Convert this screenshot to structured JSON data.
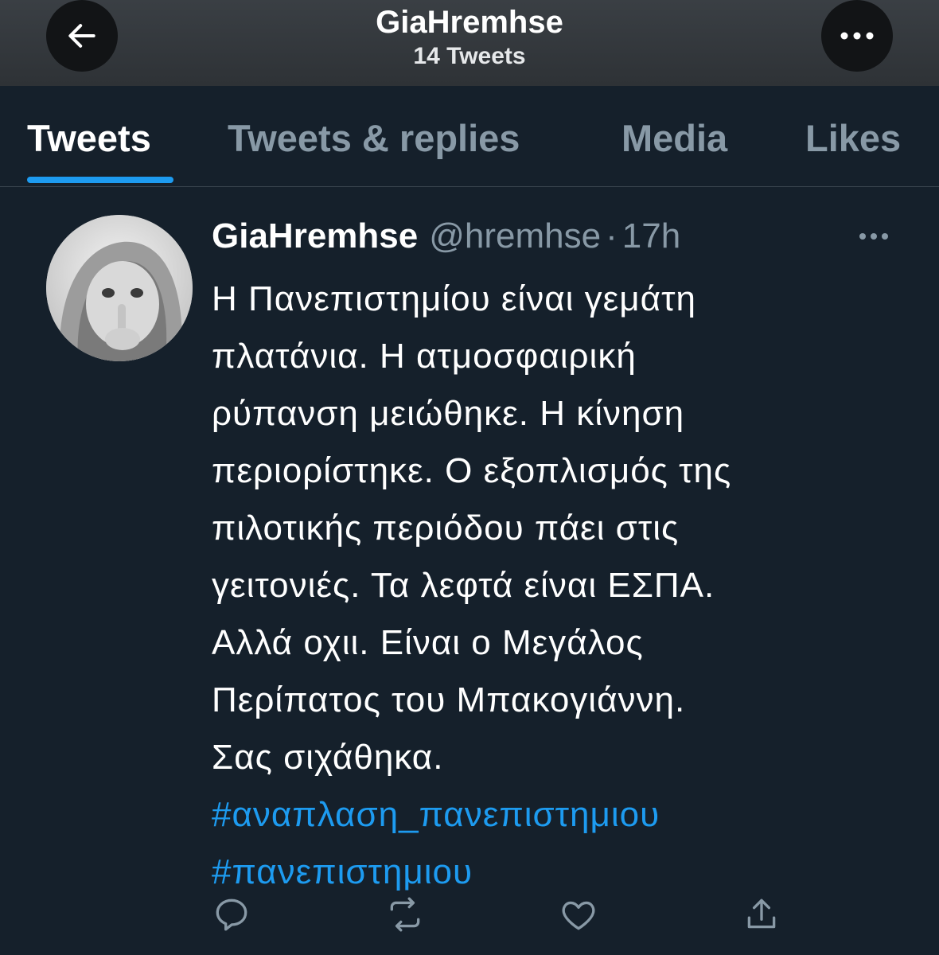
{
  "header": {
    "title": "GiaHremhse",
    "subtitle": "14 Tweets",
    "back_icon": "arrow-left-icon",
    "more_icon": "more-horizontal-icon"
  },
  "tabs": [
    {
      "label": "Tweets",
      "active": true
    },
    {
      "label": "Tweets & replies",
      "active": false
    },
    {
      "label": "Media",
      "active": false
    },
    {
      "label": "Likes",
      "active": false
    }
  ],
  "tweet": {
    "display_name": "GiaHremhse",
    "handle": "@hremhse",
    "separator": "·",
    "time": "17h",
    "text_lines": [
      "Η Πανεπιστημίου είναι γεμάτη",
      "πλατάνια. Η ατμοσφαιρική",
      "ρύπανση μειώθηκε. Η κίνηση",
      "περιορίστηκε. Ο εξοπλισμός της",
      "πιλοτικής περιόδου πάει στις",
      "γειτονιές. Τα λεφτά είναι ΕΣΠΑ.",
      "Αλλά οχιι. Είναι ο Μεγάλος",
      "Περίπατος του Μπακογιάννη.",
      "Σας σιχάθηκα."
    ],
    "hashtags": [
      "#αναπλαση_πανεπιστημιου",
      "#πανεπιστημιου"
    ]
  },
  "actions": [
    "reply-icon",
    "retweet-icon",
    "like-icon",
    "share-icon"
  ],
  "colors": {
    "background": "#15202b",
    "accent": "#1d9bf0",
    "muted": "#8899a6"
  }
}
